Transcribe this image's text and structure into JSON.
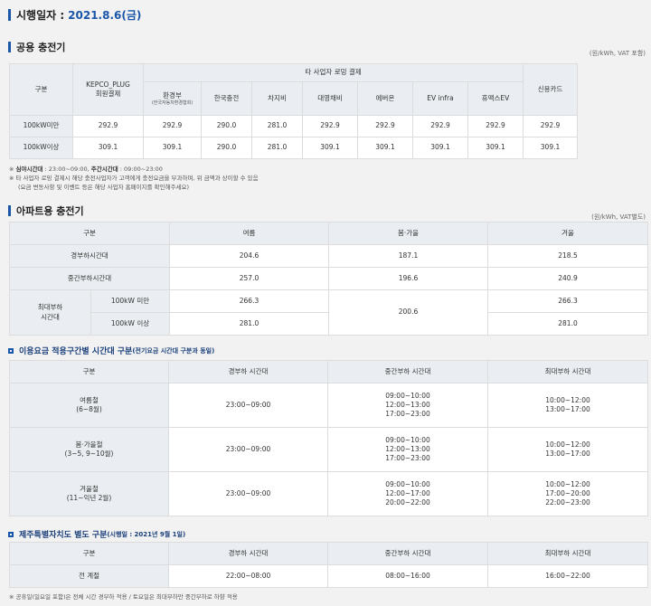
{
  "header": {
    "label": "시행일자 :",
    "date": "2021.8.6(금)"
  },
  "public": {
    "title": "공용 충전기",
    "unit": "(원/kWh, VAT 포함)",
    "head": {
      "gubun": "구분",
      "kepco_1": "KEPCO_PLUG",
      "kepco_2": "회원결제",
      "roaming": "타 사업자 로밍 결제",
      "credit": "신용카드",
      "hwan": "환경부",
      "hwan_sub": "(한국자동차환경협회)",
      "providers": [
        "한국충전",
        "차지비",
        "대영채비",
        "에버온",
        "EV infra",
        "휴맥스EV"
      ]
    },
    "rows": [
      {
        "label": "100kW미만",
        "values": [
          "292.9",
          "292.9",
          "290.0",
          "281.0",
          "292.9",
          "292.9",
          "292.9",
          "292.9",
          "292.9"
        ]
      },
      {
        "label": "100kW이상",
        "values": [
          "309.1",
          "309.1",
          "290.0",
          "281.0",
          "309.1",
          "309.1",
          "309.1",
          "309.1",
          "309.1"
        ]
      }
    ],
    "note1_b1": "심야시간대",
    "note1_t1": " : 23:00~09:00, ",
    "note1_b2": "주간시간대",
    "note1_t2": " : 09:00~23:00",
    "note2": "※ 타 사업자 로밍 결제시 해당 충전사업자가 고객에게 충전요금을 부과하며, 위 금액과 상이할 수 있음",
    "note3": "(요금 변동사항 및 이벤트 등은 해당 사업자 홈페이지를 확인해주세요)"
  },
  "apt": {
    "title": "아파트용 충전기",
    "unit": "(원/kWh, VAT별도)",
    "head": {
      "gubun": "구분",
      "summer": "여름",
      "spring": "봄·가을",
      "winter": "겨울"
    },
    "light": {
      "label": "경부하시간대",
      "summer": "204.6",
      "spring": "187.1",
      "winter": "218.5"
    },
    "mid": {
      "label": "중간부하시간대",
      "summer": "257.0",
      "spring": "196.6",
      "winter": "240.9"
    },
    "peak": {
      "label1": "최대부하",
      "label2": "시간대",
      "under": {
        "label": "100kW 미만",
        "summer": "266.3",
        "winter": "266.3"
      },
      "over": {
        "label": "100kW 이상",
        "summer": "281.0",
        "winter": "281.0"
      },
      "spring": "200.6"
    }
  },
  "periods": {
    "title": "이용요금 적용구간별 시간대 구분",
    "title_small": "(전기요금 시간대 구분과 동일)",
    "head": {
      "gubun": "구분",
      "light": "경부하 시간대",
      "mid": "중간부하 시간대",
      "peak": "최대부하 시간대"
    },
    "rows": [
      {
        "season": "여름철",
        "months": "(6~8월)",
        "light": "23:00~09:00",
        "mid": [
          "09:00~10:00",
          "12:00~13:00",
          "17:00~23:00"
        ],
        "peak": [
          "10:00~12:00",
          "13:00~17:00"
        ]
      },
      {
        "season": "봄·가을철",
        "months": "(3~5, 9~10월)",
        "light": "23:00~09:00",
        "mid": [
          "09:00~10:00",
          "12:00~13:00",
          "17:00~23:00"
        ],
        "peak": [
          "10:00~12:00",
          "13:00~17:00"
        ]
      },
      {
        "season": "겨울철",
        "months": "(11~익년 2월)",
        "light": "23:00~09:00",
        "mid": [
          "09:00~10:00",
          "12:00~17:00",
          "20:00~22:00"
        ],
        "peak": [
          "10:00~12:00",
          "17:00~20:00",
          "22:00~23:00"
        ]
      }
    ]
  },
  "jeju": {
    "title": "제주특별자치도 별도 구분",
    "title_small": "(시행일 : 2021년 9월 1일)",
    "head": {
      "gubun": "구분",
      "light": "경부하 시간대",
      "mid": "중간부하 시간대",
      "peak": "최대부하 시간대"
    },
    "row": {
      "label": "전 계절",
      "light": "22:00~08:00",
      "mid": "08:00~16:00",
      "peak": "16:00~22:00"
    },
    "note": "※ 공휴일(일요일 포함)은 전체 시간 경부하 적용 / 토요일은 최대부하만 중간부하로 하향 적용"
  }
}
